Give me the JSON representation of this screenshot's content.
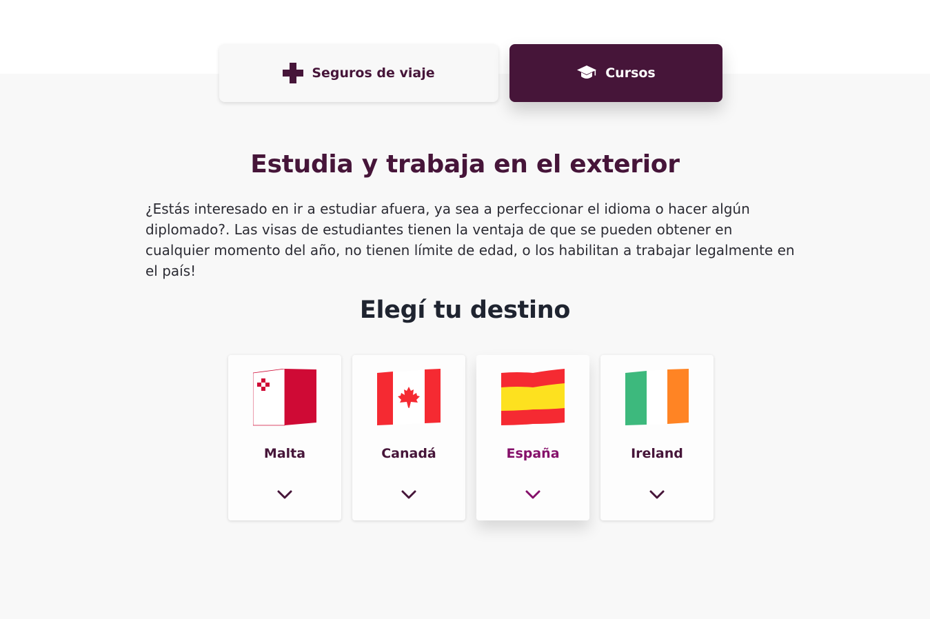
{
  "tabs": [
    {
      "label": "Seguros de viaje",
      "icon": "plus-icon",
      "active": false
    },
    {
      "label": "Cursos",
      "icon": "graduation-cap-icon",
      "active": true
    }
  ],
  "section": {
    "title": "Estudia y trabaja en el exterior",
    "description": "¿Estás interesado en ir a estudiar afuera, ya sea a perfeccionar el idioma o hacer algún diplomado?. Las visas de estudiantes tienen la ventaja de que se pueden obtener en cualquier momento del año, no tienen límite de edad, o los habilitan a trabajar legalmente en el país!"
  },
  "destinations": {
    "title": "Elegí tu destino",
    "items": [
      {
        "name": "Malta",
        "flag": "malta-flag-icon",
        "expand_icon": "chevron-down-icon"
      },
      {
        "name": "Canadá",
        "flag": "canada-flag-icon",
        "expand_icon": "chevron-down-icon"
      },
      {
        "name": "España",
        "flag": "spain-flag-icon",
        "expand_icon": "chevron-down-icon",
        "highlighted": true
      },
      {
        "name": "Ireland",
        "flag": "ireland-flag-icon",
        "expand_icon": "chevron-down-icon"
      }
    ]
  },
  "colors": {
    "brand": "#461539",
    "accent": "#85106a",
    "background": "#f8f8f8"
  }
}
